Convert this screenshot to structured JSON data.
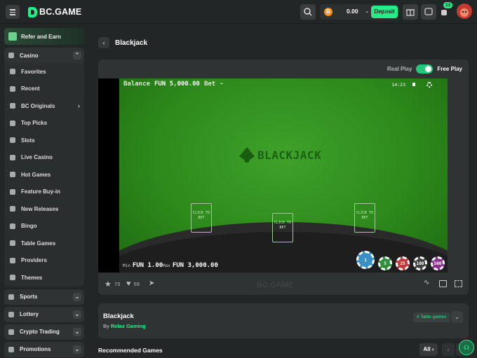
{
  "header": {
    "logo_text": "BC.GAME",
    "balance": "0.00",
    "currency_icon": "B",
    "deposit_label": "Deposit",
    "notification_count": "13"
  },
  "sidebar": {
    "refer_label": "Refer and Earn",
    "casino_label": "Casino",
    "casino_items": [
      {
        "label": "Favorites",
        "icon": "star-icon"
      },
      {
        "label": "Recent",
        "icon": "clock-icon"
      },
      {
        "label": "BC Originals",
        "icon": "bc-icon"
      },
      {
        "label": "Top Picks",
        "icon": "grid-icon"
      },
      {
        "label": "Slots",
        "icon": "slots-icon"
      },
      {
        "label": "Live Casino",
        "icon": "live-icon"
      },
      {
        "label": "Hot Games",
        "icon": "fire-icon"
      },
      {
        "label": "Feature Buy-in",
        "icon": "feature-icon"
      },
      {
        "label": "New Releases",
        "icon": "rocket-icon"
      },
      {
        "label": "Bingo",
        "icon": "bingo-icon"
      },
      {
        "label": "Table Games",
        "icon": "table-icon"
      },
      {
        "label": "Providers",
        "icon": "providers-icon"
      },
      {
        "label": "Themes",
        "icon": "themes-icon"
      }
    ],
    "sports_label": "Sports",
    "lottery_label": "Lottery",
    "crypto_label": "Crypto Trading",
    "promotions_label": "Promotions"
  },
  "page": {
    "title": "Blackjack",
    "real_play": "Real Play",
    "free_play": "Free Play"
  },
  "game": {
    "balance_label": "Balance",
    "balance_value": "FUN 5,000.00",
    "bet_label": "Bet",
    "bet_value": "-",
    "clock": "14:23",
    "logo_text": "BLACKJACK",
    "click_to_bet": "CLICK TO BET",
    "min_label": "Min",
    "min_value": "FUN 1.00",
    "max_label": "Max",
    "max_value": "FUN 3,000.00",
    "chips": [
      "1",
      "5",
      "25",
      "100",
      "500"
    ],
    "chip_colors": [
      "#3a8fc4",
      "#2f8f3a",
      "#c43a3a",
      "#444444",
      "#8a2f8f"
    ]
  },
  "footer": {
    "likes": "73",
    "favorites": "59",
    "watermark": "BC.GAME"
  },
  "info": {
    "title": "Blackjack",
    "by_prefix": "By",
    "provider": "Relax Gaming",
    "tag": "# Table games"
  },
  "recommended": {
    "title": "Recommended Games",
    "all_label": "All"
  }
}
